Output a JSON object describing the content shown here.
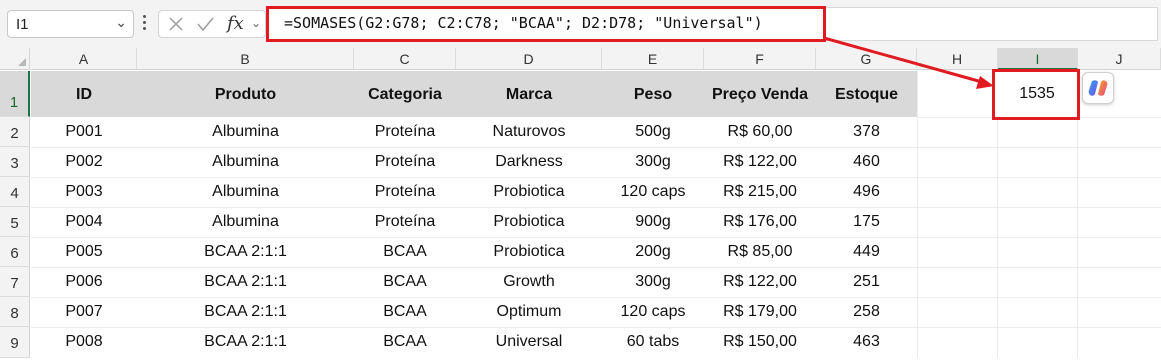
{
  "formula_bar": {
    "name_box": "I1",
    "formula": "=SOMASES(G2:G78; C2:C78; \"BCAA\"; D2:D78; \"Universal\")"
  },
  "columns": [
    "A",
    "B",
    "C",
    "D",
    "E",
    "F",
    "G",
    "H",
    "I",
    "J"
  ],
  "rows": [
    "1",
    "2",
    "3",
    "4",
    "5",
    "6",
    "7",
    "8",
    "9"
  ],
  "table": {
    "headers": [
      "ID",
      "Produto",
      "Categoria",
      "Marca",
      "Peso",
      "Preço Venda",
      "Estoque"
    ],
    "rows": [
      [
        "P001",
        "Albumina",
        "Proteína",
        "Naturovos",
        "500g",
        "R$ 60,00",
        "378"
      ],
      [
        "P002",
        "Albumina",
        "Proteína",
        "Darkness",
        "300g",
        "R$ 122,00",
        "460"
      ],
      [
        "P003",
        "Albumina",
        "Proteína",
        "Probiotica",
        "120 caps",
        "R$ 215,00",
        "496"
      ],
      [
        "P004",
        "Albumina",
        "Proteína",
        "Probiotica",
        "900g",
        "R$ 176,00",
        "175"
      ],
      [
        "P005",
        "BCAA 2:1:1",
        "BCAA",
        "Probiotica",
        "200g",
        "R$ 85,00",
        "449"
      ],
      [
        "P006",
        "BCAA 2:1:1",
        "BCAA",
        "Growth",
        "300g",
        "R$ 122,00",
        "251"
      ],
      [
        "P007",
        "BCAA 2:1:1",
        "BCAA",
        "Optimum",
        "120 caps",
        "R$ 179,00",
        "258"
      ],
      [
        "P008",
        "BCAA 2:1:1",
        "BCAA",
        "Universal",
        "60 tabs",
        "R$ 150,00",
        "463"
      ]
    ]
  },
  "result_cell": {
    "ref": "I1",
    "value": "1535"
  },
  "colors": {
    "highlight": "#e11b22",
    "header_band": "#d9d9d9",
    "selection": "#217346"
  },
  "icons": [
    "chevron-down-icon",
    "more-options-icon",
    "cancel-icon",
    "confirm-icon",
    "fx-icon",
    "copilot-icon",
    "arrow-annotation"
  ]
}
